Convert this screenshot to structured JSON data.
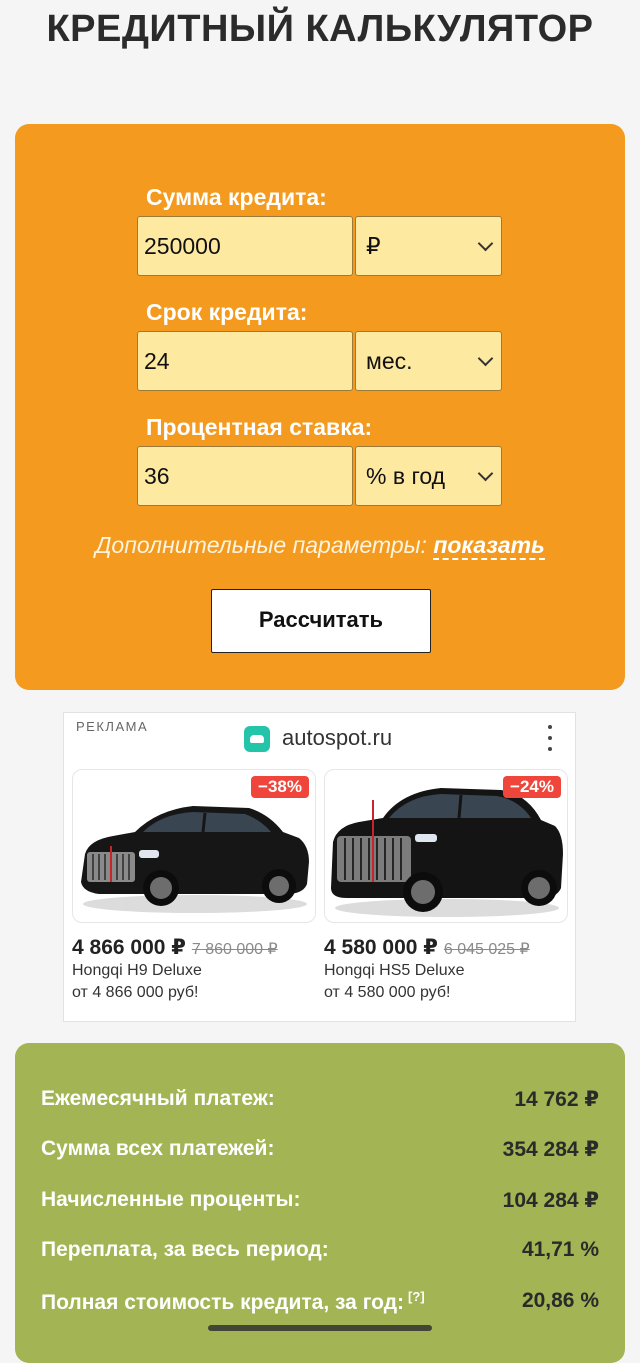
{
  "page": {
    "title": "КРЕДИТНЫЙ КАЛЬКУЛЯТОР"
  },
  "form": {
    "amount_label": "Сумма кредита:",
    "amount_value": "250000",
    "amount_unit": "₽",
    "term_label": "Срок кредита:",
    "term_value": "24",
    "term_unit": "мес.",
    "rate_label": "Процентная ставка:",
    "rate_value": "36",
    "rate_unit": "% в год",
    "extra_label": "Дополнительные параметры:",
    "extra_link": "показать",
    "submit_label": "Рассчитать"
  },
  "ad": {
    "label": "РЕКЛАМА",
    "domain": "autospot.ru",
    "products": [
      {
        "badge": "−38%",
        "price": "4 866 000 ₽",
        "old_price": "7 860 000 ₽",
        "name": "Hongqi H9 Deluxe",
        "desc": "от 4 866 000 руб!"
      },
      {
        "badge": "−24%",
        "price": "4 580 000 ₽",
        "old_price": "6 045 025 ₽",
        "name": "Hongqi HS5 Deluxe",
        "desc": "от 4 580 000 руб!"
      }
    ]
  },
  "results": {
    "rows": [
      {
        "label": "Ежемесячный платеж:",
        "value": "14 762 ₽"
      },
      {
        "label": "Сумма всех платежей:",
        "value": "354 284 ₽"
      },
      {
        "label": "Начисленные проценты:",
        "value": "104 284 ₽"
      },
      {
        "label": "Переплата, за весь период:",
        "value": "41,71 %"
      },
      {
        "label": "Полная стоимость кредита, за год:",
        "value": "20,86 %",
        "note": "[?]"
      }
    ]
  },
  "colors": {
    "calc_bg": "#f39a1f",
    "input_bg": "#fde9a0",
    "results_bg": "#a2b453",
    "badge": "#f0453a",
    "ad_logo": "#23c4a8"
  }
}
